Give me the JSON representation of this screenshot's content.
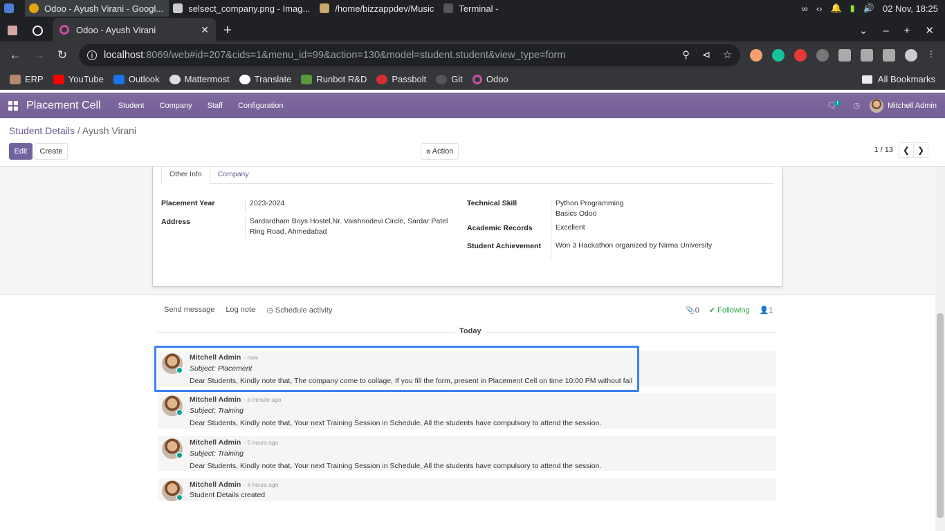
{
  "os_bar": {
    "apps": [
      {
        "label": "Odoo - Ayush Virani - Googl...",
        "active": true
      },
      {
        "label": "selsect_company.png - Imag..."
      },
      {
        "label": "/home/bizzappdev/Music"
      },
      {
        "label": "Terminal -"
      }
    ],
    "clock": "02 Nov, 18:25"
  },
  "browser": {
    "tab_title": "Odoo - Ayush Virani",
    "url_host": "localhost",
    "url_rest": ":8069/web#id=207&cids=1&menu_id=99&action=130&model=student.student&view_type=form",
    "bookmarks": [
      "ERP",
      "YouTube",
      "Outlook",
      "Mattermost",
      "Translate",
      "Runbot R&D",
      "Passbolt",
      "Git",
      "Odoo"
    ],
    "all_bookmarks": "All Bookmarks"
  },
  "odoo_nav": {
    "brand": "Placement Cell",
    "menu": [
      "Student",
      "Company",
      "Staff",
      "Configuration"
    ],
    "msg_badge": "1",
    "user": "Mitchell Admin"
  },
  "control_panel": {
    "breadcrumb_parent": "Student Details",
    "breadcrumb_sep": "/",
    "breadcrumb_current": "Ayush Virani",
    "edit_label": "Edit",
    "create_label": "Create",
    "action_label": "Action",
    "pager": "1 / 13"
  },
  "form": {
    "tabs": [
      "Other Info",
      "Company"
    ],
    "placement_year_label": "Placement Year",
    "placement_year": "2023-2024",
    "address_label": "Address",
    "address_line1": "Sardardham Boys Hostel,Nr. Vaishnodevi Circle, Sardar Patel",
    "address_line2": "Ring Road, Ahmedabad",
    "tech_skill_label": "Technical Skill",
    "tech_skill_1": "Python Programming",
    "tech_skill_2": "Basics Odoo",
    "academic_label": "Academic Records",
    "academic": "Excellent",
    "achievement_label": "Student Achievement",
    "achievement": "Won 3 Hackathon organized by Nirma University"
  },
  "chatter": {
    "send_message": "Send message",
    "log_note": "Log note",
    "schedule_activity": "Schedule activity",
    "attachments": "0",
    "following": "Following",
    "followers": "1",
    "today": "Today",
    "messages": [
      {
        "author": "Mitchell Admin",
        "when": "- now",
        "subject": "Subject: Placement",
        "body": "Dear Students, Kindly note that, The company come to collage, If you fill the form, present in Placement Cell on time 10:00 PM without fail"
      },
      {
        "author": "Mitchell Admin",
        "when": "- a minute ago",
        "subject": "Subject: Training",
        "body": "Dear Students, Kindly note that, Your next Training Session in Schedule, All the students have compulsory to attend the session."
      },
      {
        "author": "Mitchell Admin",
        "when": "- 5 hours ago",
        "subject": "Subject: Training",
        "body": "Dear Students, Kindly note that, Your next Training Session in Schedule, All the students have compulsory to attend the session."
      },
      {
        "author": "Mitchell Admin",
        "when": "- 6 hours ago",
        "subject": "",
        "body": "Student Details created"
      }
    ]
  }
}
